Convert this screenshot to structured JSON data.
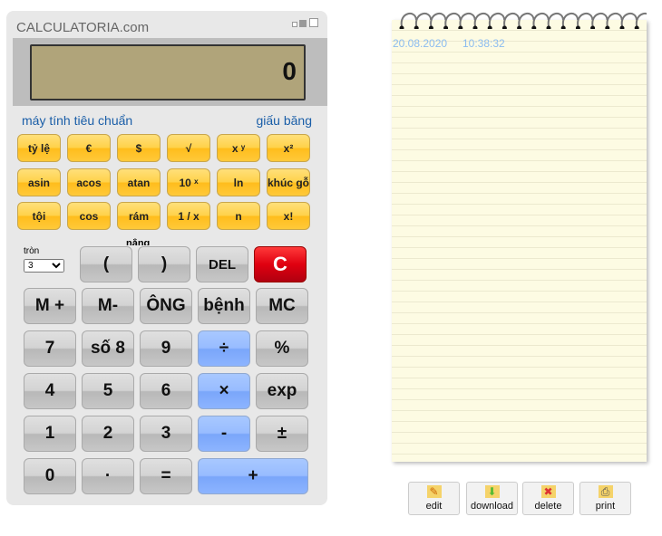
{
  "calculator": {
    "brand": "CALCULATORIA.com",
    "display": "0",
    "mode_link": "máy tính tiêu chuẩn",
    "hide_tape_link": "giấu băng",
    "function_rows": [
      [
        "tỷ lệ",
        "€",
        "$",
        "√",
        "x ʸ",
        "x²"
      ],
      [
        "asin",
        "acos",
        "atan",
        "10 ˣ",
        "ln",
        "khúc gỗ"
      ],
      [
        "tội",
        "cos",
        "rám",
        "1 / x",
        "n",
        "x!"
      ]
    ],
    "round_label": "tròn",
    "round_value": "3",
    "hidden_label": "nẳng",
    "paren_open": "(",
    "paren_close": ")",
    "del": "DEL",
    "clear": "C",
    "keypad": [
      [
        "M +",
        "M-",
        "ÔNG",
        "bệnh",
        "MC"
      ],
      [
        "7",
        "số 8",
        "9",
        "÷",
        "%"
      ],
      [
        "4",
        "5",
        "6",
        "×",
        "exp"
      ],
      [
        "1",
        "2",
        "3",
        "-",
        "±"
      ],
      [
        "0",
        "·",
        "=",
        "+"
      ]
    ],
    "accent_blue": "#8cb4ff",
    "accent_yellow": "#ffc93a",
    "accent_red": "#e00010"
  },
  "notepad": {
    "date": "20.08.2020",
    "time": "10:38:32",
    "buttons": [
      {
        "label": "edit",
        "icon": "edit-icon"
      },
      {
        "label": "download",
        "icon": "download-icon"
      },
      {
        "label": "delete",
        "icon": "delete-icon"
      },
      {
        "label": "print",
        "icon": "print-icon"
      }
    ]
  }
}
